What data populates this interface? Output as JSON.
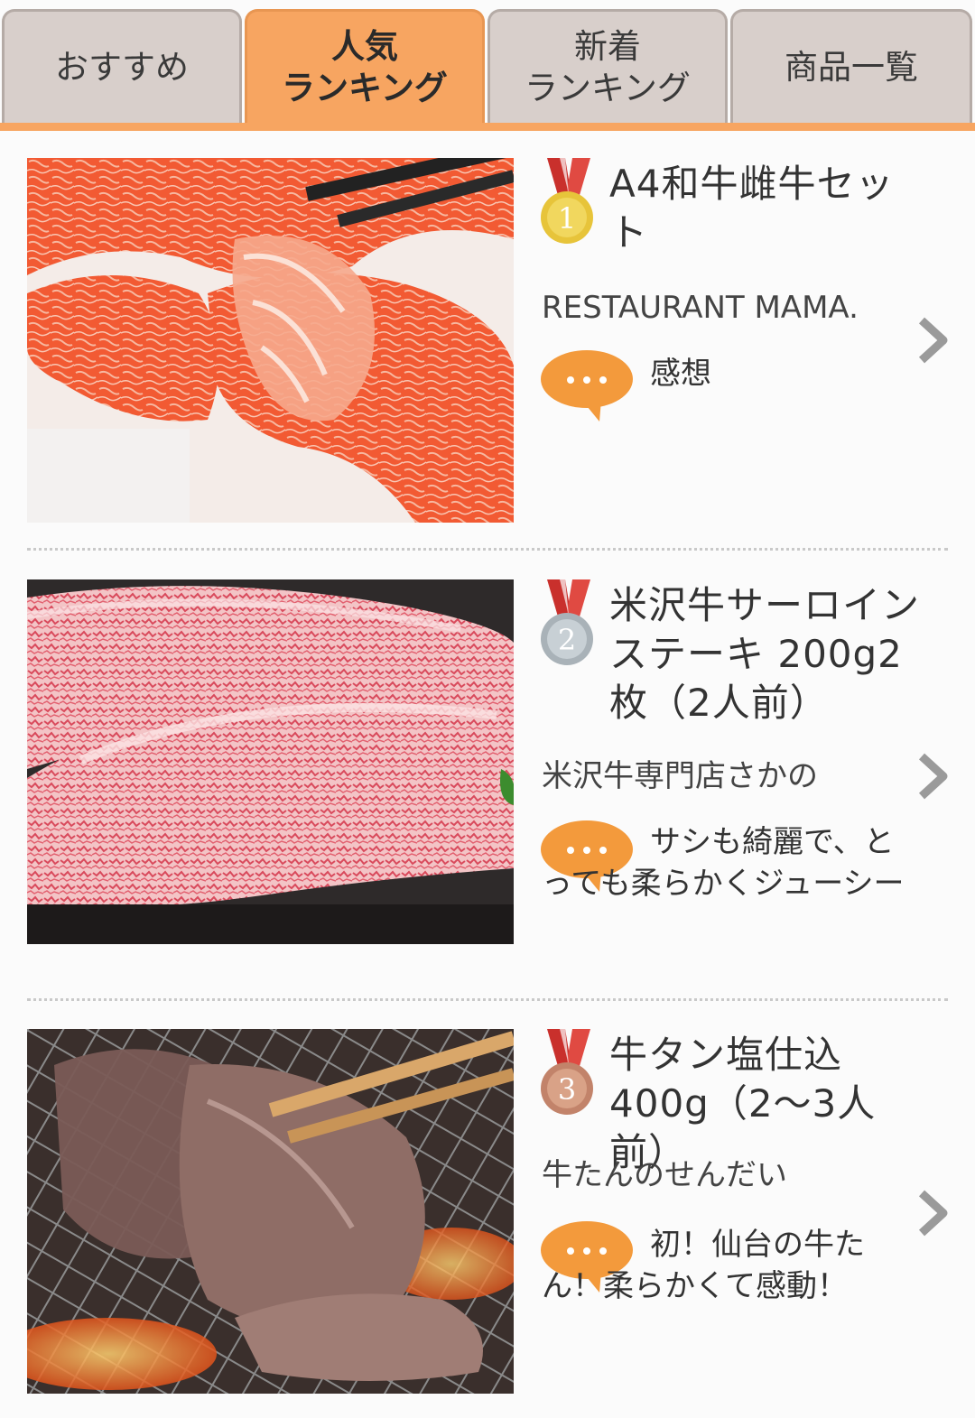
{
  "tabs": [
    {
      "label": "おすすめ",
      "active": false
    },
    {
      "label": "人気\nランキング",
      "active": true
    },
    {
      "label": "新着\nランキング",
      "active": false
    },
    {
      "label": "商品一覧",
      "active": false
    }
  ],
  "colors": {
    "accent": "#f7a561",
    "tab_inactive": "#d8cfcb",
    "bubble": "#f39a3c",
    "gold": "#e7c43a",
    "silver": "#b9c1c6",
    "bronze": "#c98a6b",
    "ribbon": "#c9302c"
  },
  "items": [
    {
      "rank_icon": "gold-medal-icon",
      "rank_numeral": "1",
      "title": "A4和牛雌牛セット",
      "shop": "RESTAURANT MAMA.",
      "comment": "感想",
      "image": "marbled-wagyu-slices-with-chopsticks"
    },
    {
      "rank_icon": "silver-medal-icon",
      "rank_numeral": "2",
      "title": "米沢牛サーロインステーキ 200g2枚（2人前）",
      "shop": "米沢牛専門店さかの",
      "comment": "サシも綺麗で、とっても柔らかくジューシー",
      "image": "marbled-sirloin-steaks"
    },
    {
      "rank_icon": "bronze-medal-icon",
      "rank_numeral": "3",
      "title": "牛タン塩仕込400g（2〜3人前）",
      "shop": "牛たんのせんだい",
      "comment": "初！仙台の牛たん！柔らかくて感動！",
      "image": "beef-tongue-on-grill"
    }
  ]
}
